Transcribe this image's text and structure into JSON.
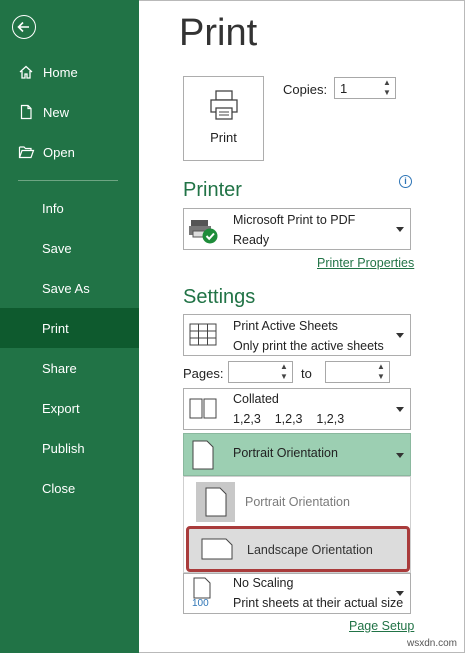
{
  "sidebar": {
    "items": [
      {
        "label": "Home"
      },
      {
        "label": "New"
      },
      {
        "label": "Open"
      },
      {
        "label": "Info"
      },
      {
        "label": "Save"
      },
      {
        "label": "Save As"
      },
      {
        "label": "Print"
      },
      {
        "label": "Share"
      },
      {
        "label": "Export"
      },
      {
        "label": "Publish"
      },
      {
        "label": "Close"
      }
    ],
    "active": "Print",
    "color": "#217346",
    "active_color": "#0e5a2e"
  },
  "main": {
    "title": "Print",
    "print_button_label": "Print",
    "copies_label": "Copies:",
    "copies_value": "1",
    "printer": {
      "heading": "Printer",
      "name": "Microsoft Print to PDF",
      "status": "Ready",
      "properties_link": "Printer Properties"
    },
    "settings": {
      "heading": "Settings",
      "what_to_print": {
        "title": "Print Active Sheets",
        "subtitle": "Only print the active sheets"
      },
      "pages_label": "Pages:",
      "pages_from": "",
      "to_label": "to",
      "pages_to": "",
      "collation": {
        "title": "Collated",
        "subtitle": "1,2,3    1,2,3    1,2,3"
      },
      "orientation": {
        "selected": "Portrait Orientation",
        "highlight_color": "#9ccfb2"
      },
      "orientation_options": [
        "Portrait Orientation",
        "Landscape Orientation"
      ],
      "scaling": {
        "title": "No Scaling",
        "subtitle": "Print sheets at their actual size",
        "icon_text": "100"
      },
      "page_setup_link": "Page Setup"
    }
  },
  "watermark": "wsxdn.com",
  "accent_color": "#217346"
}
